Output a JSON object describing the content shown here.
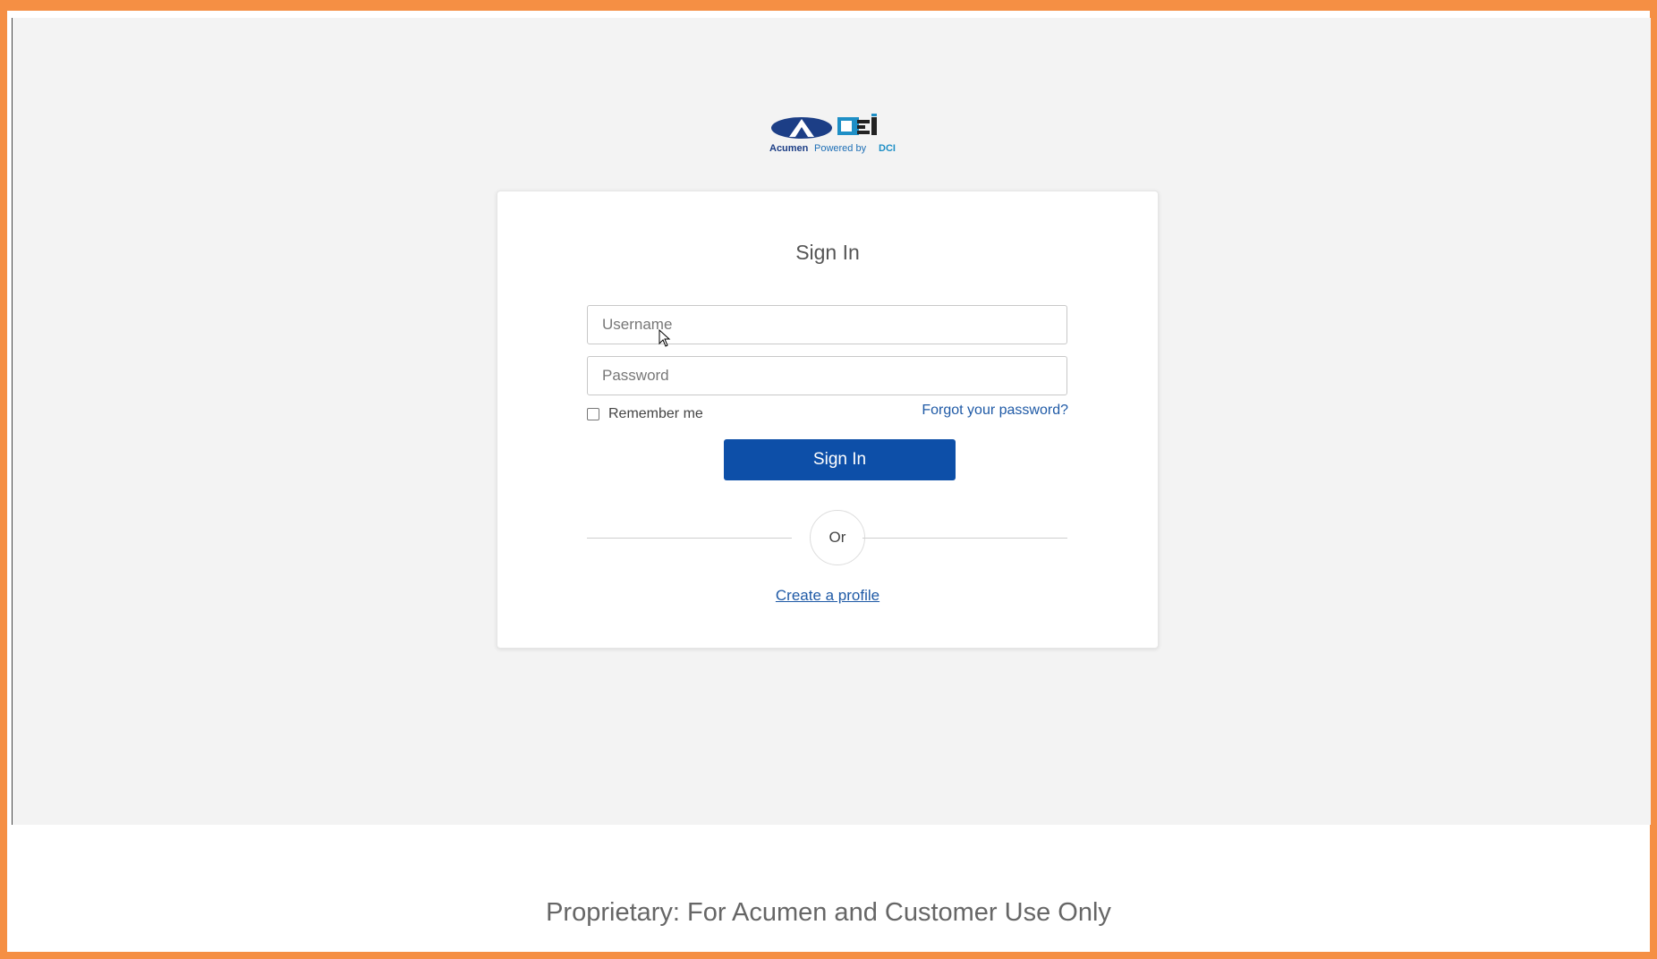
{
  "logo": {
    "brand_mark": "DCI",
    "tagline_prefix": "Acumen",
    "tagline_mid": "Powered by",
    "tagline_suffix": "DCI",
    "colors": {
      "navy": "#1c3e86",
      "teal": "#1e8fc6",
      "dark": "#222222"
    }
  },
  "signin": {
    "title": "Sign In",
    "username_placeholder": "Username",
    "username_value": "",
    "password_placeholder": "Password",
    "password_value": "",
    "remember_label": "Remember me",
    "remember_checked": false,
    "forgot_label": "Forgot your password?",
    "submit_label": "Sign In",
    "divider_label": "Or",
    "create_profile_label": "Create a profile"
  },
  "footer": {
    "text": "Proprietary: For Acumen and Customer Use Only"
  },
  "colors": {
    "frame_border": "#f58f44",
    "primary_button": "#0d4fa8",
    "link": "#1f5aa6",
    "page_background": "#f3f3f3"
  }
}
